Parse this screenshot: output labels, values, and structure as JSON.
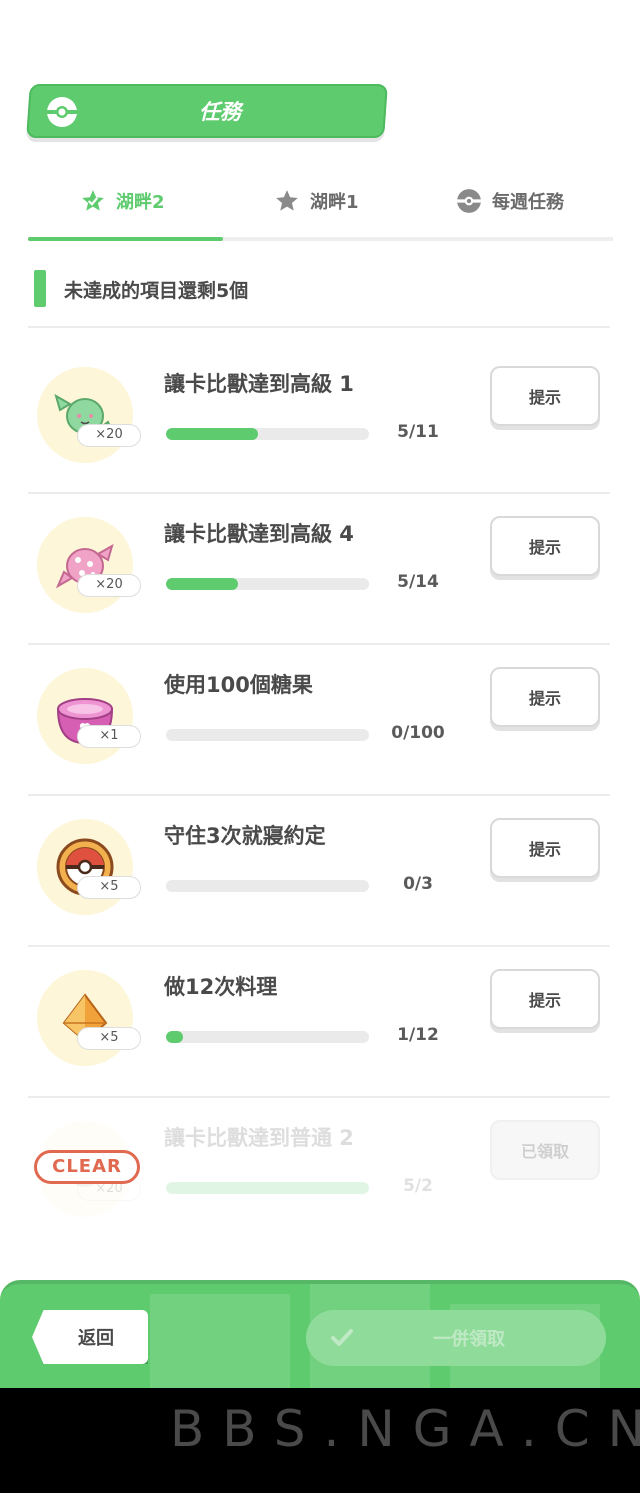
{
  "header": {
    "title": "任務",
    "logo_icon": "poke-ball-icon"
  },
  "tabs": [
    {
      "label": "湖畔2",
      "icon": "star-icon",
      "active": true
    },
    {
      "label": "湖畔1",
      "icon": "star-icon",
      "active": false
    },
    {
      "label": "每週任務",
      "icon": "poke-ball-icon",
      "active": false
    }
  ],
  "remaining_text": "未達成的項目還剩5個",
  "tasks": [
    {
      "title": "讓卡比獸達到高級 1",
      "reward_icon": "green-candy-icon",
      "reward_qty": "×20",
      "progress_text": "5/11",
      "progress": 0.4545,
      "button": "提示"
    },
    {
      "title": "讓卡比獸達到高級 4",
      "reward_icon": "pink-candy-icon",
      "reward_qty": "×20",
      "progress_text": "5/14",
      "progress": 0.3571,
      "button": "提示"
    },
    {
      "title": "使用100個糖果",
      "reward_icon": "pink-incense-pot-icon",
      "reward_qty": "×1",
      "progress_text": "0/100",
      "progress": 0,
      "button": "提示"
    },
    {
      "title": "守住3次就寢約定",
      "reward_icon": "poke-ball-biscuit-icon",
      "reward_qty": "×5",
      "progress_text": "0/3",
      "progress": 0,
      "button": "提示"
    },
    {
      "title": "做12次料理",
      "reward_icon": "orange-shard-icon",
      "reward_qty": "×5",
      "progress_text": "1/12",
      "progress": 0.0833,
      "button": "提示"
    },
    {
      "title": "讓卡比獸達到普通 2",
      "reward_icon": "candy-icon",
      "reward_qty": "×20",
      "progress_text": "5/2",
      "progress": 1,
      "button": "已領取",
      "stamp": "CLEAR"
    }
  ],
  "bottom": {
    "back_label": "返回",
    "claim_all_label": "一併領取"
  },
  "watermark": "BBS.NGA.CN",
  "colors": {
    "accent": "#5ecb6e",
    "clear_stamp": "#e0694f",
    "icon_bg": "#fdf6d8"
  }
}
